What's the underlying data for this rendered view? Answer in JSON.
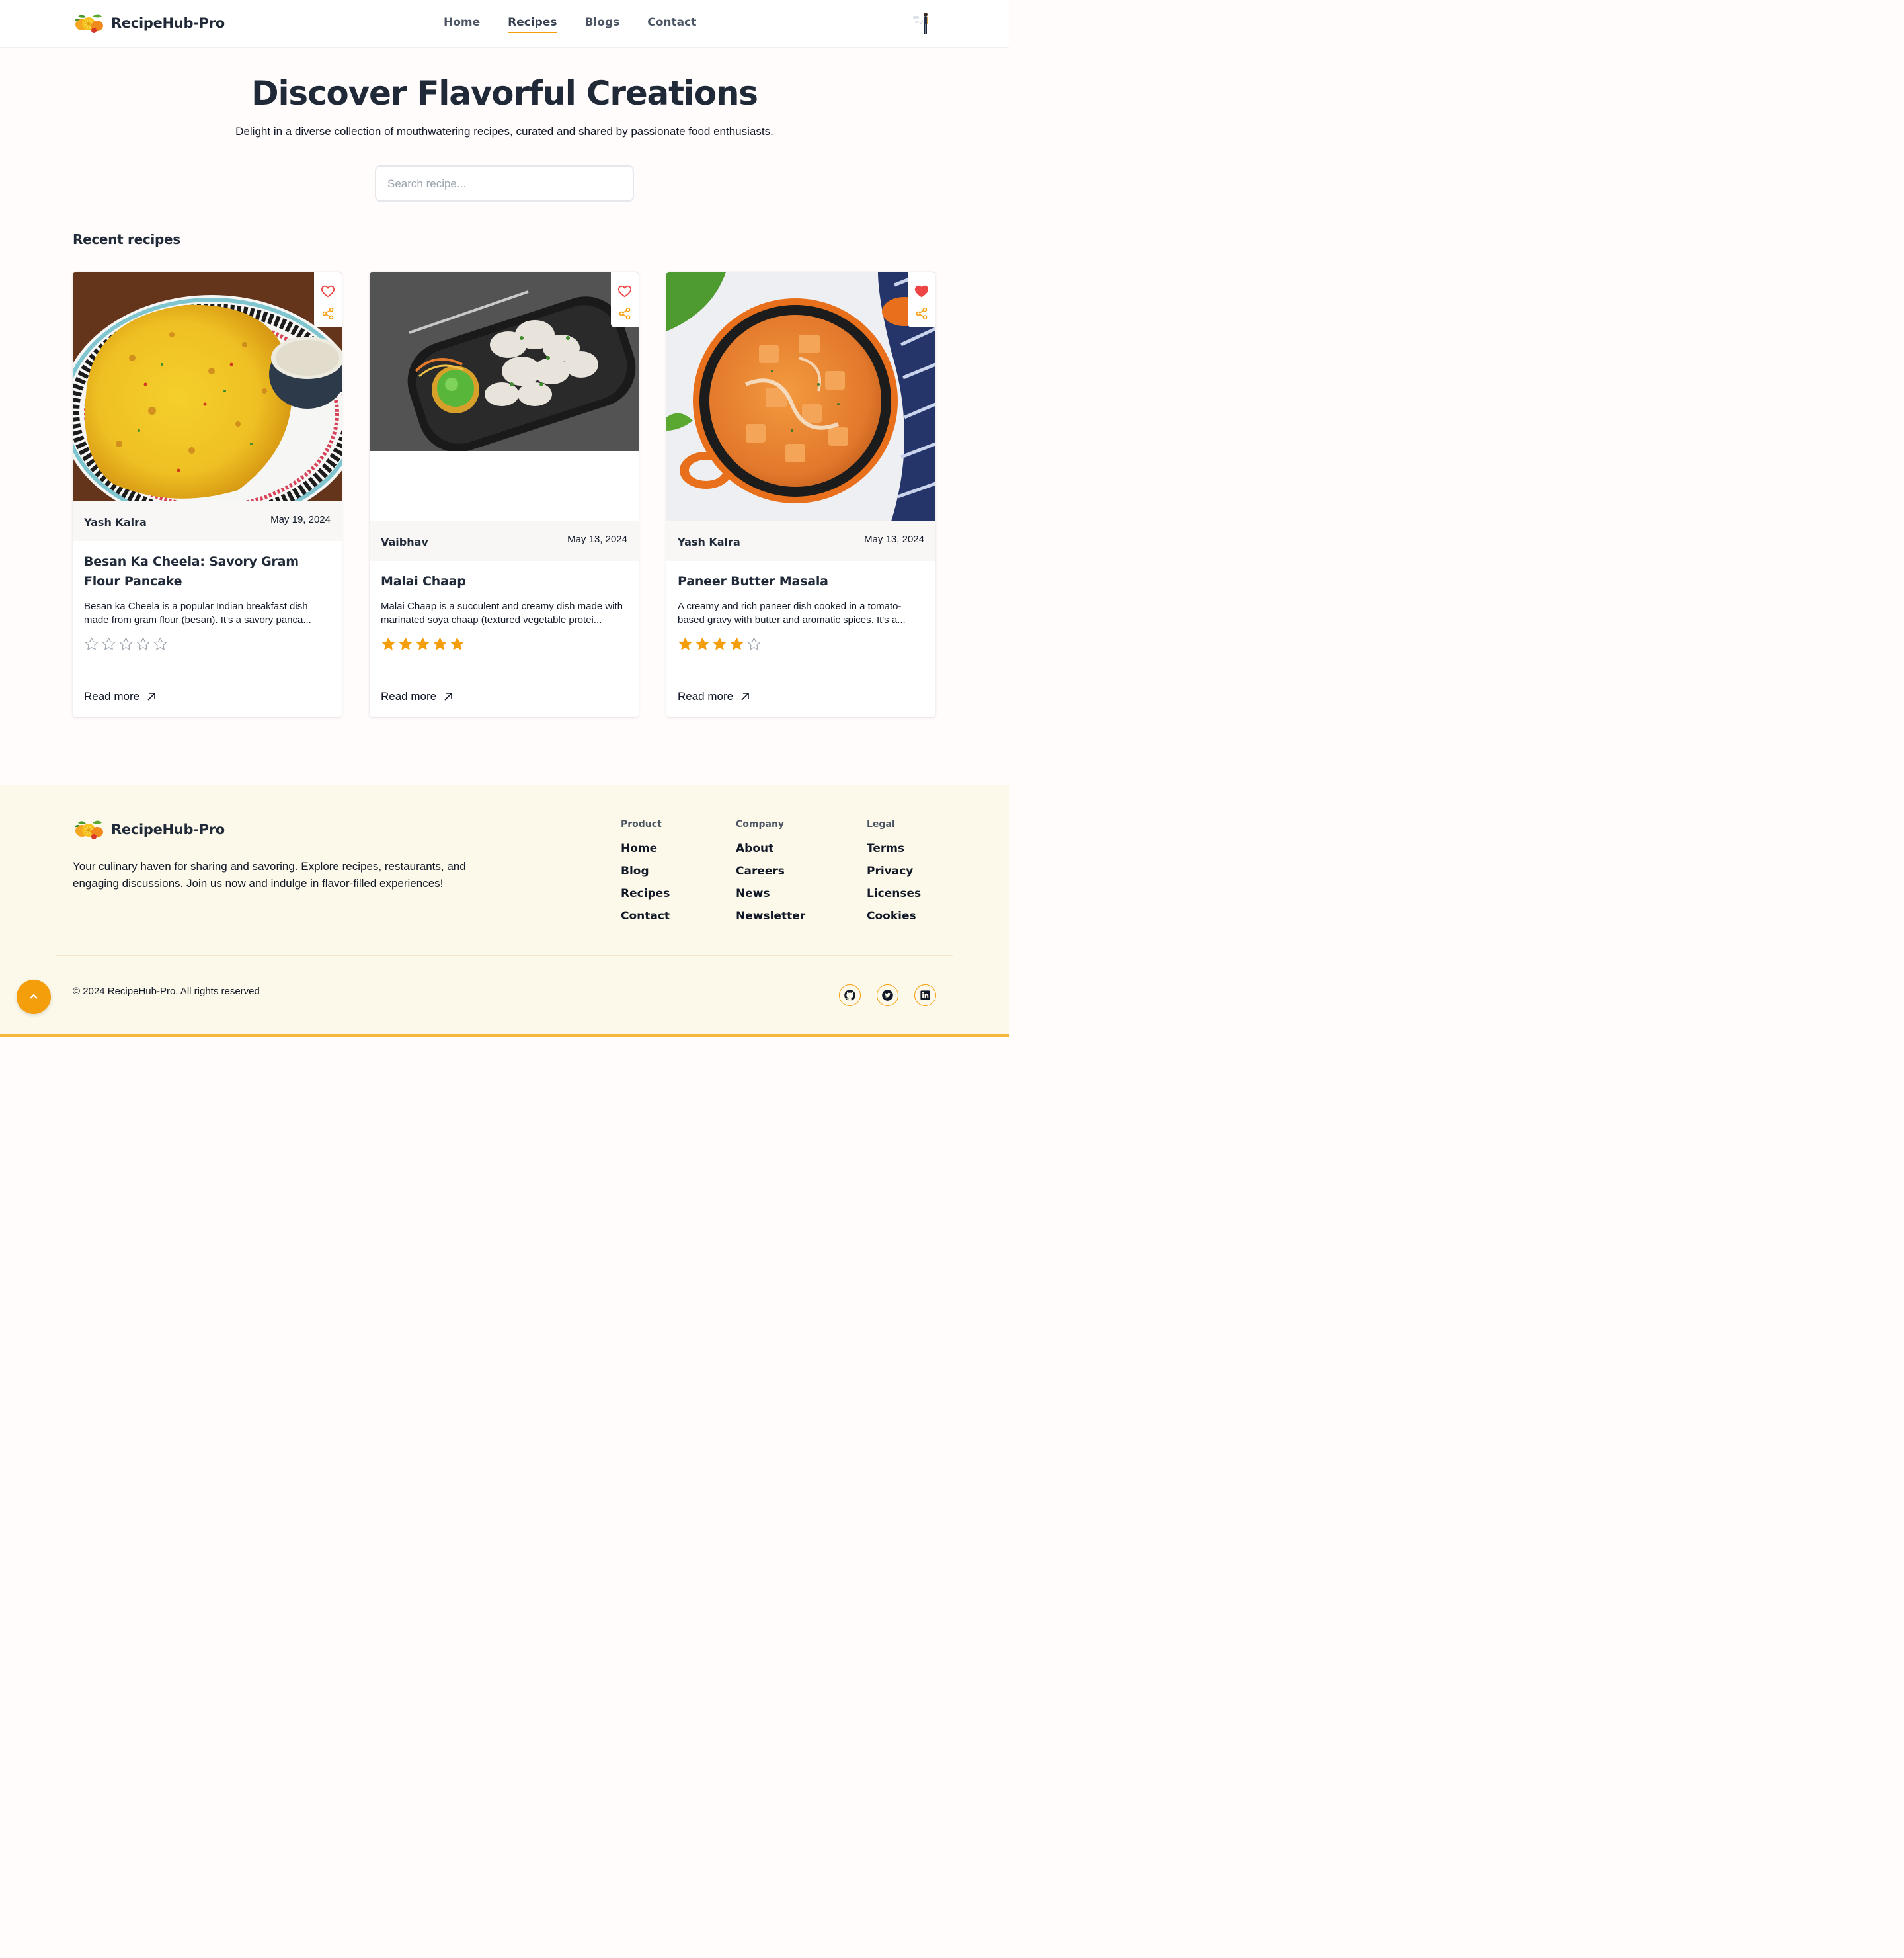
{
  "brand": {
    "name": "RecipeHub-Pro",
    "accent": "#f59e0b"
  },
  "nav": {
    "items": [
      {
        "label": "Home",
        "active": false
      },
      {
        "label": "Recipes",
        "active": true
      },
      {
        "label": "Blogs",
        "active": false
      },
      {
        "label": "Contact",
        "active": false
      }
    ]
  },
  "hero": {
    "title": "Discover Flavorful Creations",
    "subtitle": "Delight in a diverse collection of mouthwatering recipes, curated and shared by passionate food enthusiasts.",
    "search_placeholder": "Search recipe..."
  },
  "recent": {
    "title": "Recent recipes",
    "cards": [
      {
        "author": "Yash Kalra",
        "date": "May 19, 2024",
        "title": "Besan Ka Cheela: Savory Gram Flour Pancake",
        "description": "Besan ka Cheela is a popular Indian breakfast dish made from gram flour (besan). It's a savory panca...",
        "rating": 0,
        "liked": false,
        "read_more": "Read more",
        "image_icon": "besan-cheela-photo"
      },
      {
        "author": "Vaibhav",
        "date": "May 13, 2024",
        "title": "Malai Chaap",
        "description": "Malai Chaap is a succulent and creamy dish made with marinated soya chaap (textured vegetable protei...",
        "rating": 5,
        "liked": false,
        "read_more": "Read more",
        "image_icon": "malai-chaap-photo"
      },
      {
        "author": "Yash Kalra",
        "date": "May 13, 2024",
        "title": "Paneer Butter Masala",
        "description": "A creamy and rich paneer dish cooked in a tomato-based gravy with butter and aromatic spices. It's a...",
        "rating": 4,
        "liked": true,
        "read_more": "Read more",
        "image_icon": "paneer-butter-masala-photo"
      }
    ]
  },
  "footer": {
    "description": "Your culinary haven for sharing and savoring. Explore recipes, restaurants, and engaging discussions. Join us now and indulge in flavor-filled experiences!",
    "columns": [
      {
        "title": "Product",
        "links": [
          "Home",
          "Blog",
          "Recipes",
          "Contact"
        ]
      },
      {
        "title": "Company",
        "links": [
          "About",
          "Careers",
          "News",
          "Newsletter"
        ]
      },
      {
        "title": "Legal",
        "links": [
          "Terms",
          "Privacy",
          "Licenses",
          "Cookies"
        ]
      }
    ],
    "copyright": "© 2024 RecipeHub-Pro. All rights reserved",
    "social": [
      "github-icon",
      "twitter-icon",
      "linkedin-icon"
    ]
  },
  "colors": {
    "star": "#f59e0b",
    "heart": "#ef4444",
    "share": "#f59e0b",
    "footer_bg": "#fdf9ea"
  }
}
